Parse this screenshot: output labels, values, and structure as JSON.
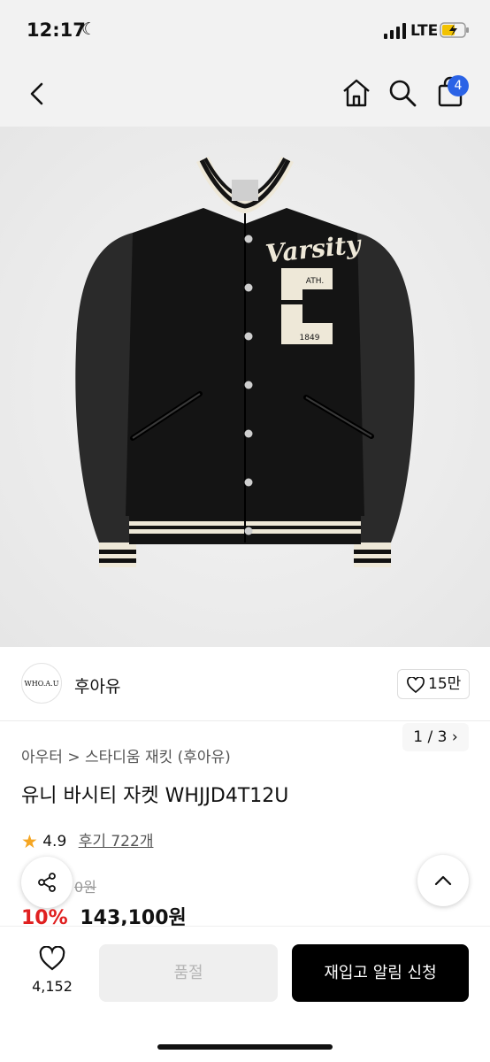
{
  "status_bar": {
    "time": "12:17",
    "network": "LTE"
  },
  "nav": {
    "cart_count": "4"
  },
  "gallery": {
    "pager": "1 / 3",
    "patch_script": "Varsity",
    "patch_letter": "C",
    "patch_top": "ATH.",
    "patch_year": "1849"
  },
  "brand": {
    "logo_text": "WHO.A.U",
    "name": "후아유",
    "like_count": "15만"
  },
  "breadcrumb": {
    "level1": "아우터",
    "separator": ">",
    "level2": "스타디움 재킷 (후아유)"
  },
  "product": {
    "title": "유니 바시티 자켓 WHJJD4T12U",
    "rating": "4.9",
    "reviews_label": "후기 722개",
    "original_price": "0원",
    "discount": "10%",
    "price": "143,100원"
  },
  "bottom_bar": {
    "wish_count": "4,152",
    "soldout_label": "품절",
    "restock_label": "재입고 알림 신청"
  },
  "colors": {
    "accent_badge": "#2b63e6",
    "discount": "#e02020",
    "primary_button": "#000000"
  }
}
